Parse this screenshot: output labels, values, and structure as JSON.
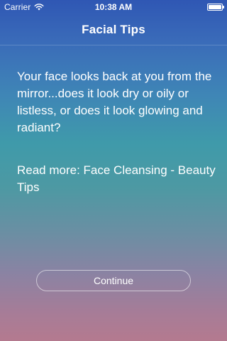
{
  "status_bar": {
    "carrier": "Carrier",
    "time": "10:38 AM",
    "icons": [
      "wifi-icon",
      "battery-icon"
    ]
  },
  "nav": {
    "title": "Facial Tips"
  },
  "content": {
    "intro": "Your face looks back at you from the mirror...does it look dry or oily or listless, or does it look glowing and radiant?",
    "read_more": "Read more: Face Cleansing - Beauty Tips"
  },
  "actions": {
    "continue_label": "Continue"
  },
  "colors": {
    "text": "#ffffff",
    "background_top": "#2f57b4",
    "background_middle": "#3f9aaa",
    "background_bottom": "#b47a8f"
  }
}
